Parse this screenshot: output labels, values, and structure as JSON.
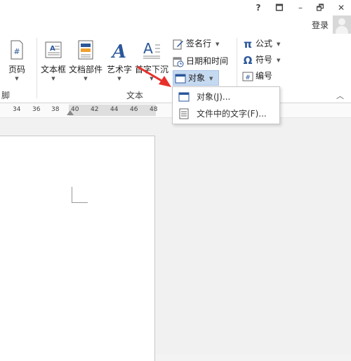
{
  "window": {
    "help": "?",
    "ribbon_display": "🗖",
    "minimize": "–",
    "restore": "🗗",
    "close": "✕"
  },
  "account": {
    "login_label": "登录"
  },
  "ribbon": {
    "left_edge_label": "脚",
    "page_number_label": "页码",
    "text_box_label": "文本框",
    "quick_parts_label": "文档部件",
    "wordart_label": "艺术字",
    "dropcap_label": "首字下沉",
    "signature_line_label": "签名行",
    "date_time_label": "日期和时间",
    "object_label": "对象",
    "equation_label": "公式",
    "symbol_label": "符号",
    "number_label": "编号",
    "text_group_label": "文本"
  },
  "ruler": {
    "ticks": [
      "34",
      "36",
      "38",
      "40",
      "42",
      "44",
      "46",
      "48"
    ]
  },
  "dropdown": {
    "items": [
      {
        "label": "对象(J)...",
        "icon": "object-window-icon"
      },
      {
        "label": "文件中的文字(F)...",
        "icon": "document-text-icon"
      }
    ]
  },
  "colors": {
    "accent": "#2b579a",
    "arrow": "#e8302a",
    "selected": "#c5d9f1"
  }
}
